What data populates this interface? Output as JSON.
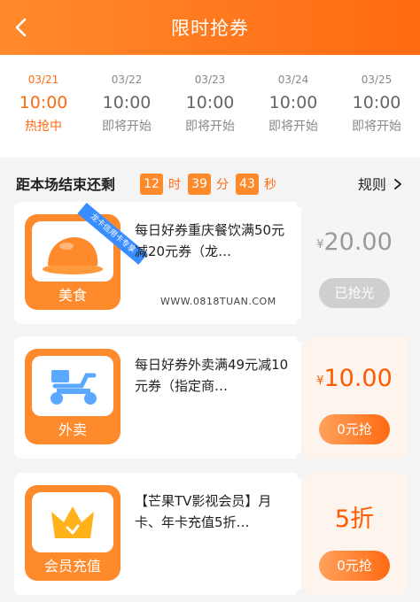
{
  "header": {
    "title": "限时抢券"
  },
  "sessions": [
    {
      "date": "03/21",
      "time": "10:00",
      "status": "热抢中"
    },
    {
      "date": "03/22",
      "time": "10:00",
      "status": "即将开始"
    },
    {
      "date": "03/23",
      "time": "10:00",
      "status": "即将开始"
    },
    {
      "date": "03/24",
      "time": "10:00",
      "status": "即将开始"
    },
    {
      "date": "03/25",
      "time": "10:00",
      "status": "即将开始"
    }
  ],
  "countdown": {
    "label": "距本场结束还剩",
    "hours": "12",
    "hours_unit": "时",
    "minutes": "39",
    "minutes_unit": "分",
    "seconds": "43",
    "seconds_unit": "秒",
    "rules": "规则"
  },
  "coupons": [
    {
      "category": "美食",
      "ribbon": "龙卡信用卡专享",
      "title": "每日好券重庆餐饮满50元减20元券（龙…",
      "currency": "¥",
      "price": "20.00",
      "button": "已抢光"
    },
    {
      "category": "外卖",
      "title": "每日好券外卖满49元减10元券（指定商…",
      "currency": "¥",
      "price": "10.00",
      "button": "0元抢"
    },
    {
      "category": "会员充值",
      "title": "【芒果TV影视会员】月卡、年卡充值5折…",
      "discount": "5折",
      "button": "0元抢"
    }
  ],
  "watermark": "WWW.0818TUAN.COM",
  "colors": {
    "brand": "#ff6a12",
    "ribbon": "#3a8dff",
    "soldout": "#cfcfcf"
  },
  "icons": {
    "back": "chevron-left-icon",
    "rules": "chevron-right-icon",
    "food": "roast-chicken-icon",
    "delivery": "scooter-icon",
    "vip": "crown-icon"
  }
}
